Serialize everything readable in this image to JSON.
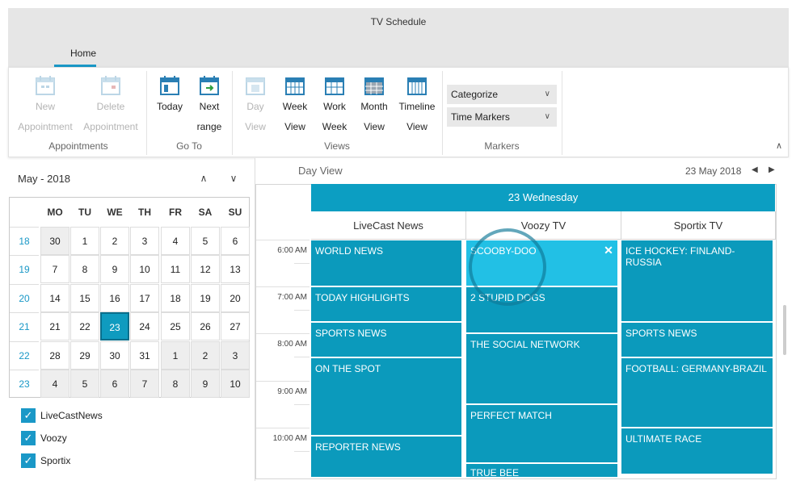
{
  "window": {
    "title": "TV Schedule"
  },
  "tabs": [
    {
      "label": "Home"
    }
  ],
  "ribbon": {
    "buttons": {
      "new_appointment": {
        "l1": "New",
        "l2": "Appointment"
      },
      "delete_appointment": {
        "l1": "Delete",
        "l2": "Appointment"
      },
      "today": {
        "l1": "Today",
        "l2": ""
      },
      "next_range": {
        "l1": "Next",
        "l2": "range"
      },
      "day_view": {
        "l1": "Day",
        "l2": "View"
      },
      "week_view": {
        "l1": "Week",
        "l2": "View"
      },
      "work_week": {
        "l1": "Work",
        "l2": "Week"
      },
      "month_view": {
        "l1": "Month",
        "l2": "View"
      },
      "timeline_view": {
        "l1": "Timeline",
        "l2": "View"
      }
    },
    "groups": {
      "appointments": "Appointments",
      "goto": "Go To",
      "views": "Views",
      "markers": "Markers"
    },
    "combos": {
      "categorize": "Categorize",
      "time_markers": "Time Markers"
    }
  },
  "calendar": {
    "header": "May - 2018",
    "dow": [
      "MO",
      "TU",
      "WE",
      "TH",
      "FR",
      "SA",
      "SU"
    ],
    "weeks": [
      {
        "num": "18",
        "days": [
          "30",
          "1",
          "2",
          "3",
          "4",
          "5",
          "6"
        ]
      },
      {
        "num": "19",
        "days": [
          "7",
          "8",
          "9",
          "10",
          "11",
          "12",
          "13"
        ]
      },
      {
        "num": "20",
        "days": [
          "14",
          "15",
          "16",
          "17",
          "18",
          "19",
          "20"
        ]
      },
      {
        "num": "21",
        "days": [
          "21",
          "22",
          "23",
          "24",
          "25",
          "26",
          "27"
        ]
      },
      {
        "num": "22",
        "days": [
          "28",
          "29",
          "30",
          "31",
          "1",
          "2",
          "3"
        ]
      },
      {
        "num": "23",
        "days": [
          "4",
          "5",
          "6",
          "7",
          "8",
          "9",
          "10"
        ]
      }
    ],
    "selected": "23"
  },
  "filters": [
    {
      "label": "LiveCastNews",
      "checked": true
    },
    {
      "label": "Voozy",
      "checked": true
    },
    {
      "label": "Sportix",
      "checked": true
    }
  ],
  "dayview": {
    "title": "Day View",
    "date": "23 May 2018",
    "day_header": "23 Wednesday",
    "channels": [
      "LiveCast News",
      "Voozy TV",
      "Sportix TV"
    ],
    "times": [
      "6:00 AM",
      "7:00 AM",
      "8:00 AM",
      "9:00 AM",
      "10:00 AM"
    ],
    "programs": {
      "c0": [
        "WORLD NEWS",
        "TODAY HIGHLIGHTS",
        "SPORTS NEWS",
        "ON THE SPOT",
        "REPORTER NEWS"
      ],
      "c1": [
        "SCOOBY-DOO",
        "2 STUPID DOGS",
        "THE SOCIAL NETWORK",
        "PERFECT MATCH",
        "TRUE BEE"
      ],
      "c2": [
        "ICE HOCKEY: FINLAND-RUSSIA",
        "SPORTS NEWS",
        "FOOTBALL: GERMANY-BRAZIL",
        "ULTIMATE RACE"
      ]
    }
  },
  "colors": {
    "accent": "#0b9abc",
    "highlight": "#22c0e5",
    "week_num": "#1a98c7"
  }
}
